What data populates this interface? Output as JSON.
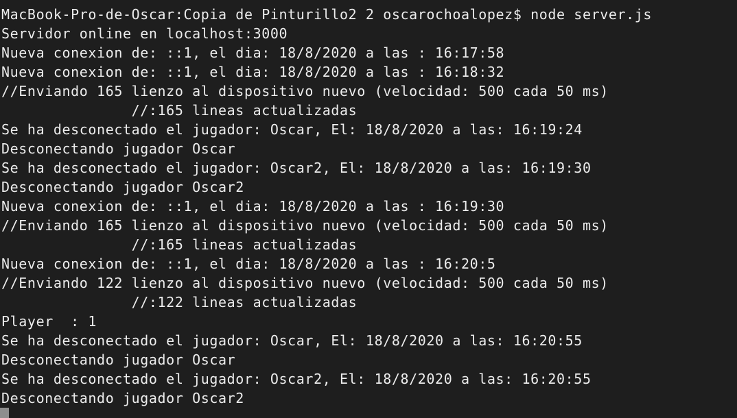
{
  "terminal": {
    "lines": [
      "MacBook-Pro-de-Oscar:Copia de Pinturillo2 2 oscarochoalopez$ node server.js",
      "Servidor online en localhost:3000",
      "Nueva conexion de: ::1, el dia: 18/8/2020 a las : 16:17:58",
      "Nueva conexion de: ::1, el dia: 18/8/2020 a las : 16:18:32",
      "//Enviando 165 lienzo al dispositivo nuevo (velocidad: 500 cada 50 ms)",
      "               //:165 lineas actualizadas",
      "Se ha desconectado el jugador: Oscar, El: 18/8/2020 a las: 16:19:24",
      "Desconectando jugador Oscar",
      "Se ha desconectado el jugador: Oscar2, El: 18/8/2020 a las: 16:19:30",
      "Desconectando jugador Oscar2",
      "Nueva conexion de: ::1, el dia: 18/8/2020 a las : 16:19:30",
      "//Enviando 165 lienzo al dispositivo nuevo (velocidad: 500 cada 50 ms)",
      "               //:165 lineas actualizadas",
      "Nueva conexion de: ::1, el dia: 18/8/2020 a las : 16:20:5",
      "//Enviando 122 lienzo al dispositivo nuevo (velocidad: 500 cada 50 ms)",
      "               //:122 lineas actualizadas",
      "Player  : 1",
      "Se ha desconectado el jugador: Oscar, El: 18/8/2020 a las: 16:20:55",
      "Desconectando jugador Oscar",
      "Se ha desconectado el jugador: Oscar2, El: 18/8/2020 a las: 16:20:55",
      "Desconectando jugador Oscar2"
    ]
  },
  "colors": {
    "background": "#1e1e1e",
    "text": "#ececec",
    "cursor": "#8e8e8e"
  }
}
